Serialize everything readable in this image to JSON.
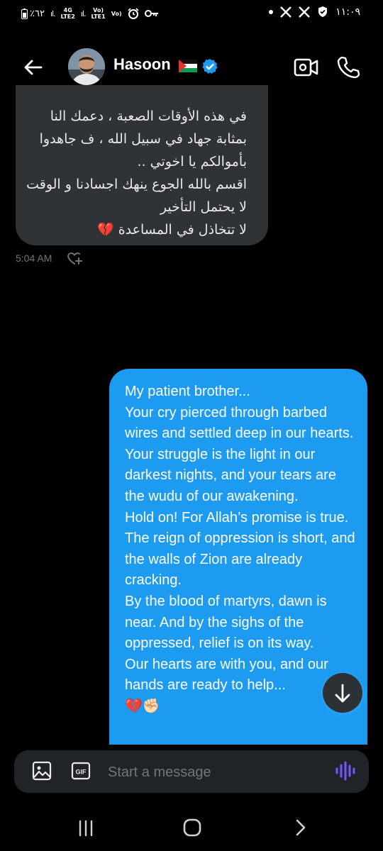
{
  "status_bar": {
    "battery": "٪٦٢",
    "net1_top": "4G",
    "net1_bottom": "LTE2",
    "net2_top": "Vo)",
    "net2_bottom": "LTE1",
    "net3_top": "Vo)",
    "time": "١١:٠٩",
    "notif_icons": [
      "x-logo-icon",
      "x-logo-icon",
      "shield-check-icon"
    ]
  },
  "header": {
    "name": "Hasoon",
    "flag": "🇵🇸",
    "back_icon": "arrow-left-icon",
    "video_icon": "video-call-icon",
    "call_icon": "phone-icon",
    "verified_icon": "verified-badge-icon",
    "accent": "#1d9bf0"
  },
  "messages": {
    "incoming": {
      "text": "في هذه الأوقات الصعبة ، دعمك النا بمثابة جهاد في سبيل الله ، ف جاهدوا بأموالكم يا اخوتي ..\nاقسم بالله الجوع ينهك اجسادنا و الوقت لا يحتمل التأخير\nلا تتخاذل في المساعدة 💔",
      "time": "5:04 AM",
      "reaction_icon": "heart-plus-icon",
      "bubble_color": "#2f3336"
    },
    "outgoing": {
      "text": "My patient brother...\nYour cry pierced through barbed wires and settled deep in our hearts.\nYour struggle is the light in our darkest nights, and your tears are the wudu of our awakening.\nHold on! For Allah’s promise is true. The reign of oppression is short, and the walls of Zion are already cracking.\nBy the blood of martyrs, dawn is near. And by the sighs of the oppressed, relief is on its way.\nOur hearts are with you, and our hands are ready to help...\n💔✊🏻",
      "bubble_color": "#1d9bf0"
    },
    "scroll_down_icon": "arrow-down-icon"
  },
  "composer": {
    "placeholder": "Start a message",
    "media_icon": "image-icon",
    "gif_label": "GIF",
    "voice_icon": "voice-wave-icon",
    "voice_color": "#7856ff"
  },
  "nav_bar": {
    "recents_icon": "recents-icon",
    "home_icon": "home-circle-icon",
    "back_icon": "chevron-right-icon"
  }
}
